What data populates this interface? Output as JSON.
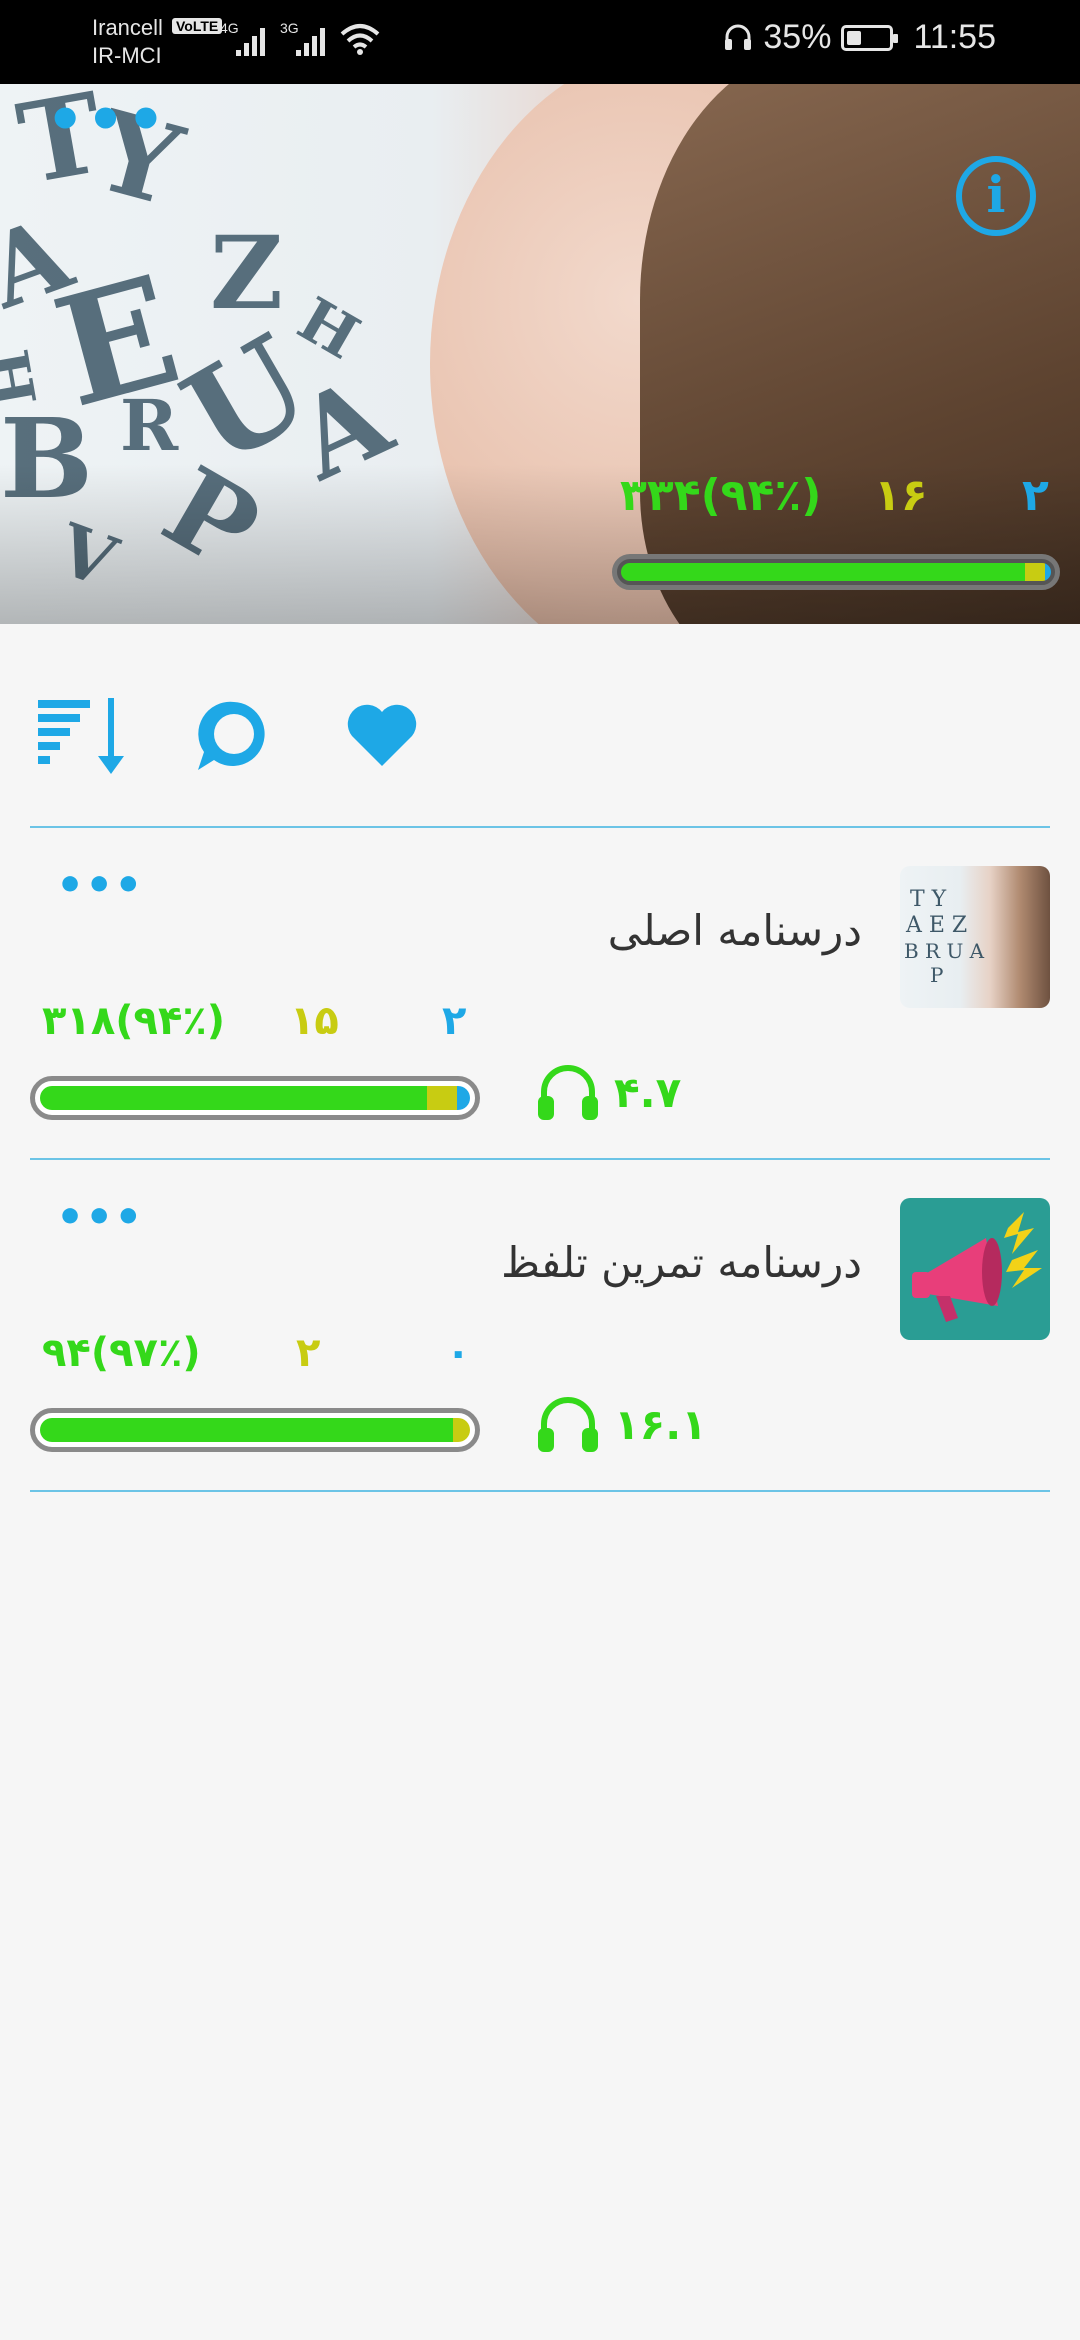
{
  "status_bar": {
    "carrier1": "Irancell",
    "carrier2": "IR-MCI",
    "volte": "VoLTE",
    "net1": "4G",
    "net2": "3G",
    "battery": "35%",
    "time": "11:55"
  },
  "hero": {
    "more_label": "•••",
    "info_label": "i",
    "stat_correct": "۳۳۴(۹۴٪)",
    "stat_partial": "۱۶",
    "stat_wrong": "۲",
    "progress": {
      "green": 0.94,
      "yellow": 0.045,
      "blue": 0.015
    }
  },
  "toolbar": {
    "sort_icon": "sort-descending-icon",
    "chat_icon": "chat-bubble-icon",
    "fav_icon": "heart-icon"
  },
  "lessons": [
    {
      "title": "درسنامه اصلی",
      "more_label": "•••",
      "stat_correct": "۳۱۸(۹۴٪)",
      "stat_partial": "۱۵",
      "stat_wrong": "۲",
      "listen": "۴.۷",
      "progress": {
        "green": 0.9,
        "yellow": 0.07,
        "blue": 0.03
      }
    },
    {
      "title": "درسنامه تمرین تلفظ",
      "more_label": "•••",
      "stat_correct": "۹۴(۹۷٪)",
      "stat_partial": "۲",
      "stat_wrong": "۰",
      "listen": "۱۶.۱",
      "progress": {
        "green": 0.96,
        "yellow": 0.04,
        "blue": 0
      }
    }
  ],
  "colors": {
    "accent": "#1ea8e6",
    "green": "#34d81a",
    "yellow": "#c8cc12"
  }
}
